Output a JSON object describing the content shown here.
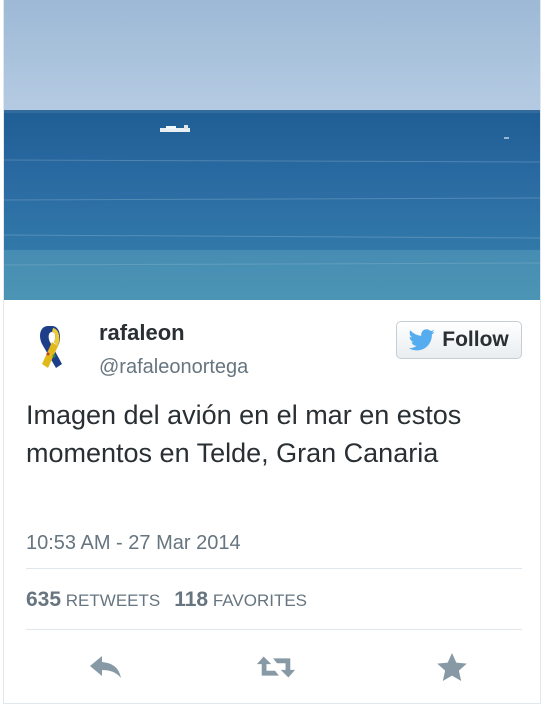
{
  "tweet": {
    "display_name": "rafaleon",
    "screen_name": "@rafaleonortega",
    "text": "Imagen del avión en el mar en estos momentos en Telde, Gran Canaria",
    "timestamp": "10:53 AM - 27 Mar 2014",
    "retweets": "635",
    "retweets_label": "RETWEETS",
    "favorites": "118",
    "favorites_label": "FAVORITES"
  },
  "follow_button": {
    "label": "Follow",
    "icon": "twitter-bird-icon"
  },
  "actions": [
    {
      "name": "reply",
      "icon": "reply-icon"
    },
    {
      "name": "retweet",
      "icon": "retweet-icon"
    },
    {
      "name": "favorite",
      "icon": "star-icon"
    }
  ],
  "colors": {
    "twitter_blue": "#55acee",
    "text_primary": "#292f33",
    "text_secondary": "#66757f",
    "action_gray": "#8899a6",
    "sea": "#2e6a9e",
    "sky": "#a7c1dc"
  }
}
